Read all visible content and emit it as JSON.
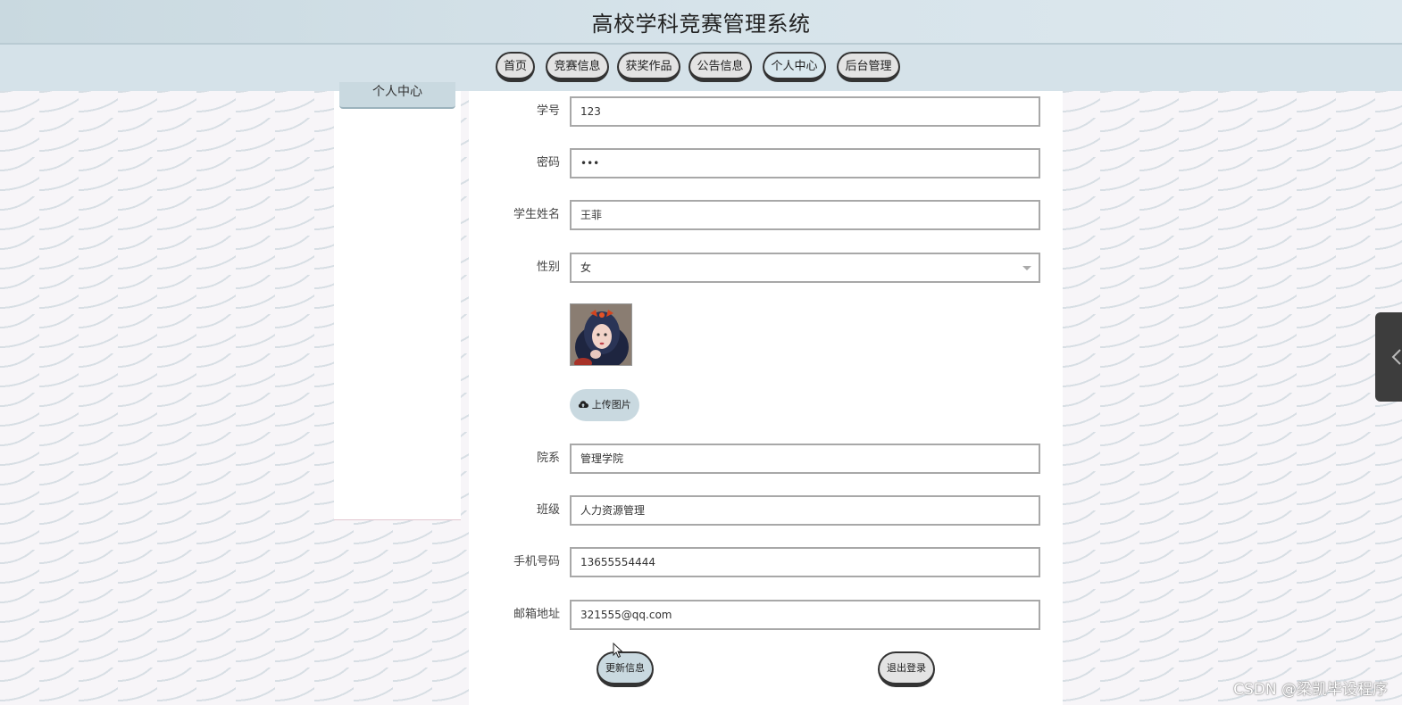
{
  "header": {
    "title": "高校学科竞赛管理系统"
  },
  "nav": {
    "items": [
      {
        "label": "首页"
      },
      {
        "label": "竞赛信息"
      },
      {
        "label": "获奖作品"
      },
      {
        "label": "公告信息"
      },
      {
        "label": "个人中心",
        "active": true
      },
      {
        "label": "后台管理"
      }
    ]
  },
  "sidebar": {
    "tab_label": "个人中心"
  },
  "form": {
    "student_id": {
      "label": "学号",
      "value": "123"
    },
    "password": {
      "label": "密码",
      "value": "•••"
    },
    "name": {
      "label": "学生姓名",
      "value": "王菲"
    },
    "gender": {
      "label": "性别",
      "value": "女"
    },
    "upload_label": "上传图片",
    "department": {
      "label": "院系",
      "value": "管理学院"
    },
    "class": {
      "label": "班级",
      "value": "人力资源管理"
    },
    "phone": {
      "label": "手机号码",
      "value": "13655554444"
    },
    "email": {
      "label": "邮箱地址",
      "value": "321555@qq.com"
    },
    "update_label": "更新信息",
    "logout_label": "退出登录"
  },
  "watermark": "CSDN @梁凯毕设程序",
  "colors": {
    "accent": "#c9d9e0",
    "header_bg": "#d6e3ea"
  }
}
